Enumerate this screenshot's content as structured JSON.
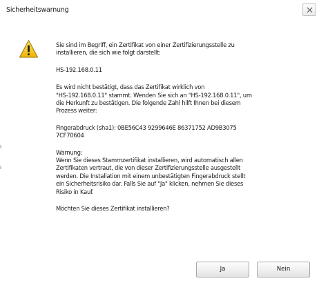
{
  "window": {
    "title": "Sicherheitswarnung",
    "close_symbol": "×"
  },
  "icon": "warning-icon",
  "message": {
    "intro": "Sie sind im Begriff, ein Zertifikat von einer Zertifizierungsstelle zu\ninstallieren, die sich wie folgt darstellt:",
    "host": "HS-192.168.0.11",
    "validation": "Es wird nicht bestätigt, dass das Zertifikat wirklich von\n\"HS-192.168.0.11\" stammt. Wenden Sie sich an \"HS-192.168.0.11\", um\ndie Herkunft zu bestätigen. Die folgende Zahl hilft Ihnen bei diesem\nProzess weiter:",
    "fingerprint": "Fingerabdruck (sha1): 0BE56C43 9299646E 86371752 AD9B3075\n7CF70604",
    "warning": "Warnung:\nWenn Sie dieses Stammzertifikat installieren, wird automatisch allen\nZertifikaten vertraut, die von dieser Zertifizierungsstelle ausgestellt\nwerden. Die Installation mit einem unbestätigten Fingerabdruck stellt\nein Sicherheitsrisiko dar. Falls Sie auf \"Ja\" klicken, nehmen Sie dieses\nRisiko in Kauf.",
    "question": "Möchten Sie dieses Zertifikat installieren?"
  },
  "buttons": {
    "yes_label": "Ja",
    "no_label": "Nein"
  },
  "colors": {
    "warning_yellow": "#f5c518",
    "warning_border": "#8a6d00",
    "text": "#1a1a1a",
    "button_border": "#a8a8a8"
  }
}
